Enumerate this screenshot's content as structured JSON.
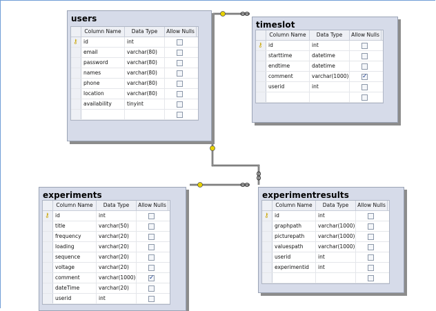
{
  "headers": {
    "column_name": "Column Name",
    "data_type": "Data Type",
    "allow_nulls": "Allow Nulls"
  },
  "tables": {
    "users": {
      "title": "users",
      "rows": [
        {
          "name": "id",
          "type": "int",
          "nulls": false,
          "key": true
        },
        {
          "name": "email",
          "type": "varchar(80)",
          "nulls": false
        },
        {
          "name": "password",
          "type": "varchar(80)",
          "nulls": false
        },
        {
          "name": "names",
          "type": "varchar(80)",
          "nulls": false
        },
        {
          "name": "phone",
          "type": "varchar(80)",
          "nulls": false
        },
        {
          "name": "location",
          "type": "varchar(80)",
          "nulls": false
        },
        {
          "name": "availability",
          "type": "tinyint",
          "nulls": false
        },
        {
          "name": "",
          "type": "",
          "nulls": false
        }
      ]
    },
    "timeslot": {
      "title": "timeslot",
      "rows": [
        {
          "name": "id",
          "type": "int",
          "nulls": false,
          "key": true
        },
        {
          "name": "starttime",
          "type": "datetime",
          "nulls": false
        },
        {
          "name": "endtime",
          "type": "datetime",
          "nulls": false
        },
        {
          "name": "comment",
          "type": "varchar(1000)",
          "nulls": true
        },
        {
          "name": "userid",
          "type": "int",
          "nulls": false
        },
        {
          "name": "",
          "type": "",
          "nulls": false
        }
      ]
    },
    "experiments": {
      "title": "experiments",
      "rows": [
        {
          "name": "id",
          "type": "int",
          "nulls": false,
          "key": true
        },
        {
          "name": "title",
          "type": "varchar(50)",
          "nulls": false
        },
        {
          "name": "frequency",
          "type": "varchar(20)",
          "nulls": false
        },
        {
          "name": "loading",
          "type": "varchar(20)",
          "nulls": false
        },
        {
          "name": "sequence",
          "type": "varchar(20)",
          "nulls": false
        },
        {
          "name": "voltage",
          "type": "varchar(20)",
          "nulls": false
        },
        {
          "name": "comment",
          "type": "varchar(1000)",
          "nulls": true
        },
        {
          "name": "dateTime",
          "type": "varchar(20)",
          "nulls": false
        },
        {
          "name": "userid",
          "type": "int",
          "nulls": false
        }
      ]
    },
    "experimentresults": {
      "title": "experimentresults",
      "rows": [
        {
          "name": "id",
          "type": "int",
          "nulls": false,
          "key": true
        },
        {
          "name": "graphpath",
          "type": "varchar(1000)",
          "nulls": false
        },
        {
          "name": "picturepath",
          "type": "varchar(1000)",
          "nulls": false
        },
        {
          "name": "valuespath",
          "type": "varchar(1000)",
          "nulls": false
        },
        {
          "name": "userid",
          "type": "int",
          "nulls": false
        },
        {
          "name": "experimentid",
          "type": "int",
          "nulls": false
        },
        {
          "name": "",
          "type": "",
          "nulls": false
        }
      ]
    }
  },
  "colors": {
    "connector": "#333333",
    "key_end": "#e8d200",
    "table_bg": "#d6dbe9"
  },
  "icons": {
    "primary_key": "key-icon",
    "checkbox": "checkbox-icon"
  }
}
